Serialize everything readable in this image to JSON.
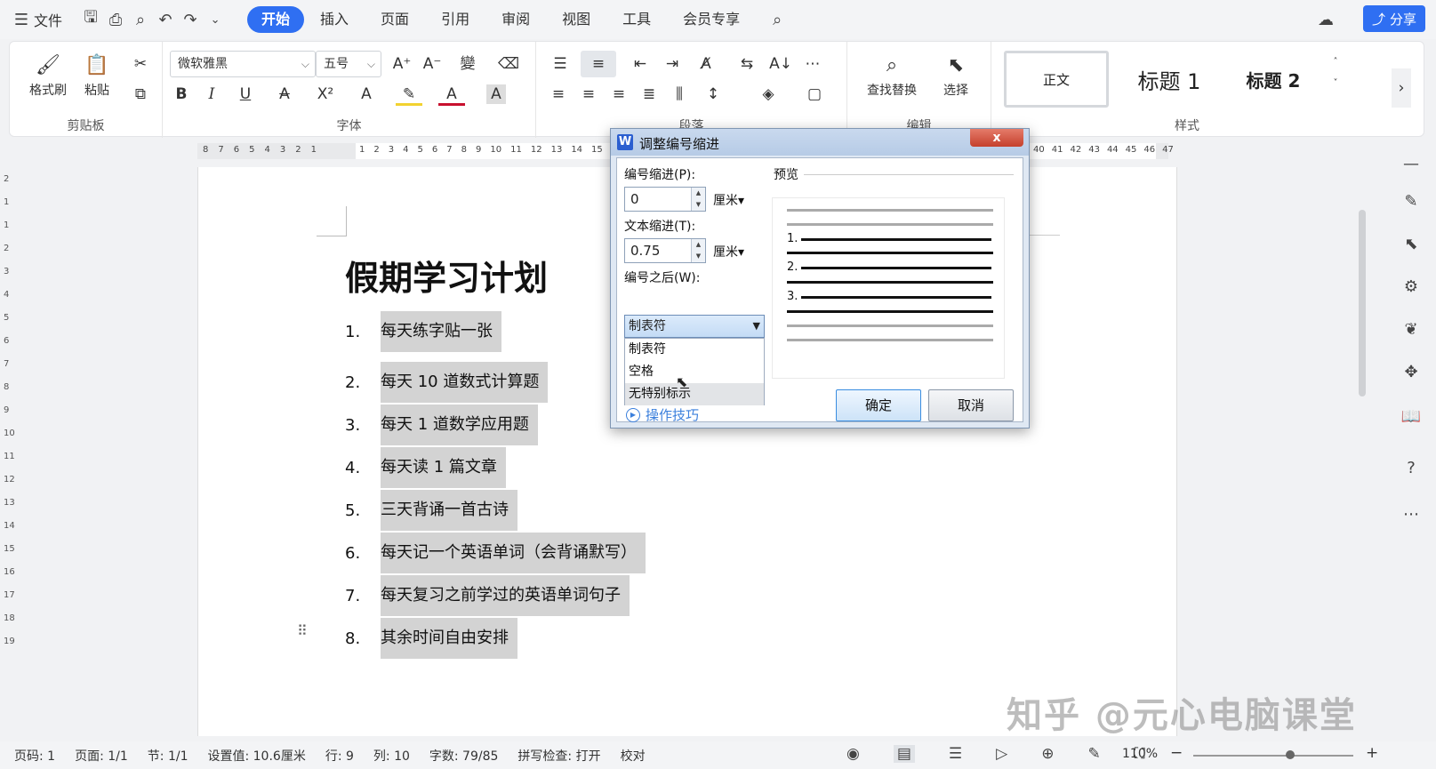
{
  "menubar": {
    "file_label": "文件",
    "tabs": [
      "开始",
      "插入",
      "页面",
      "引用",
      "审阅",
      "视图",
      "工具",
      "会员专享"
    ],
    "share_label": "分享"
  },
  "ribbon": {
    "clipboard": {
      "format_painter": "格式刷",
      "paste": "粘贴",
      "group_label": "剪贴板"
    },
    "font": {
      "font_name": "微软雅黑",
      "font_size": "五号",
      "group_label": "字体"
    },
    "paragraph": {
      "group_label": "段落"
    },
    "edit": {
      "find_replace": "查找替换",
      "select": "选择",
      "group_label": "编辑"
    },
    "styles": {
      "normal": "正文",
      "heading1": "标题 1",
      "heading2": "标题 2",
      "group_label": "样式"
    }
  },
  "ruler": {
    "left_ticks": [
      "8",
      "7",
      "6",
      "5",
      "4",
      "3",
      "2",
      "1"
    ],
    "right_ticks": [
      "1",
      "2",
      "3",
      "4",
      "5",
      "6",
      "7",
      "8",
      "9",
      "10",
      "11",
      "12",
      "13",
      "14",
      "15"
    ],
    "far_ticks": [
      "40",
      "41",
      "42",
      "43",
      "44",
      "45",
      "46",
      "47"
    ]
  },
  "vruler_ticks": [
    "2",
    "1",
    "1",
    "2",
    "3",
    "4",
    "5",
    "6",
    "7",
    "8",
    "9",
    "10",
    "11",
    "12",
    "13",
    "14",
    "15",
    "16",
    "17",
    "18",
    "19"
  ],
  "document": {
    "title": "假期学习计划",
    "items": [
      {
        "num": "1.",
        "text": "每天练字贴一张"
      },
      {
        "num": "2.",
        "text": "每天 10 道数式计算题"
      },
      {
        "num": "3.",
        "text": "每天 1 道数学应用题"
      },
      {
        "num": "4.",
        "text": "每天读 1 篇文章"
      },
      {
        "num": "5.",
        "text": "三天背诵一首古诗"
      },
      {
        "num": "6.",
        "text": "每天记一个英语单词（会背诵默写）"
      },
      {
        "num": "7.",
        "text": "每天复习之前学过的英语单词句子"
      },
      {
        "num": "8.",
        "text": "其余时间自由安排"
      }
    ]
  },
  "dialog": {
    "title": "调整编号缩进",
    "close": "x",
    "number_indent_label": "编号缩进(P):",
    "number_indent_value": "0",
    "number_indent_unit": "厘米",
    "text_indent_label": "文本缩进(T):",
    "text_indent_value": "0.75",
    "text_indent_unit": "厘米",
    "follow_label": "编号之后(W):",
    "follow_selected": "制表符",
    "follow_options": [
      "制表符",
      "空格",
      "无特别标示"
    ],
    "preview_label": "预览",
    "preview_numbers": [
      "1.",
      "2.",
      "3."
    ],
    "tips_label": "操作技巧",
    "ok_label": "确定",
    "cancel_label": "取消"
  },
  "statusbar": {
    "page_num": "页码: 1",
    "pages": "页面: 1/1",
    "section": "节: 1/1",
    "setting": "设置值: 10.6厘米",
    "row": "行: 9",
    "col": "列: 10",
    "word_count": "字数: 79/85",
    "spell_check": "拼写检查: 打开",
    "proofread": "校对",
    "zoom": "110%"
  },
  "watermark": "知乎 @元心电脑课堂"
}
